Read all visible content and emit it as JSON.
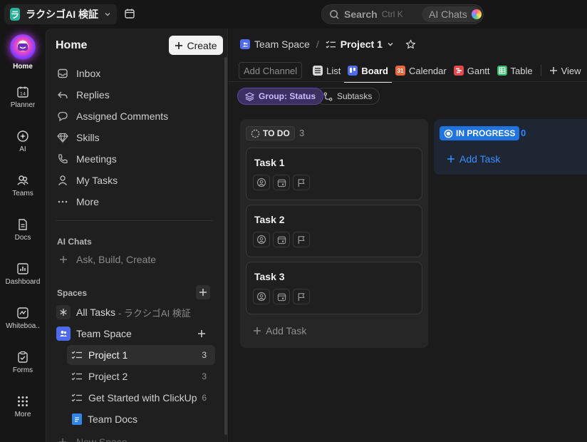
{
  "topbar": {
    "workspace_logo": "ラ",
    "workspace_name": "ラクシゴAI 検証",
    "search_label": "Search",
    "search_shortcut": "Ctrl K",
    "ai_chats_label": "AI Chats"
  },
  "rail": {
    "items": [
      {
        "label": "Home",
        "icon": "home-icon"
      },
      {
        "label": "Planner",
        "icon": "planner-icon"
      },
      {
        "label": "AI",
        "icon": "ai-icon"
      },
      {
        "label": "Teams",
        "icon": "teams-icon"
      },
      {
        "label": "Docs",
        "icon": "docs-icon"
      },
      {
        "label": "Dashboards",
        "display": "Dashboard",
        "icon": "dashboard-icon"
      },
      {
        "label": "Whiteboards",
        "display": "Whiteboa..",
        "icon": "whiteboard-icon"
      },
      {
        "label": "Forms",
        "icon": "forms-icon"
      },
      {
        "label": "More",
        "icon": "grid-icon"
      }
    ]
  },
  "sidebar": {
    "title": "Home",
    "create_label": "Create",
    "nav": [
      {
        "label": "Inbox",
        "icon": "inbox-icon"
      },
      {
        "label": "Replies",
        "icon": "reply-icon"
      },
      {
        "label": "Assigned Comments",
        "icon": "comment-icon"
      },
      {
        "label": "Skills",
        "icon": "diamond-icon"
      },
      {
        "label": "Meetings",
        "icon": "phone-icon"
      },
      {
        "label": "My Tasks",
        "icon": "user-icon"
      },
      {
        "label": "More",
        "icon": "ellipsis-icon"
      }
    ],
    "ai_chats_title": "AI Chats",
    "ai_chats_prompt": "Ask, Build, Create",
    "spaces_title": "Spaces",
    "all_tasks_label": "All Tasks",
    "all_tasks_suffix": "- ラクシゴAI 検証",
    "team_space_label": "Team Space",
    "tree": [
      {
        "label": "Project 1",
        "count": "3",
        "active": true
      },
      {
        "label": "Project 2",
        "count": "3"
      },
      {
        "label": "Get Started with ClickUp",
        "count": "6"
      },
      {
        "label": "Team Docs",
        "count": ""
      }
    ],
    "new_space_label": "New Space"
  },
  "main": {
    "breadcrumb": {
      "space": "Team Space",
      "separator": "/",
      "project": "Project 1"
    },
    "add_channel": "Add Channel",
    "views": [
      {
        "label": "List",
        "icon": "list-icon"
      },
      {
        "label": "Board",
        "icon": "board-icon",
        "active": true
      },
      {
        "label": "Calendar",
        "icon": "calendar-icon",
        "color": "#e8663d",
        "badge": "31"
      },
      {
        "label": "Gantt",
        "icon": "gantt-icon",
        "color": "#e5484d"
      },
      {
        "label": "Table",
        "icon": "table-icon",
        "color": "#2fb86a"
      }
    ],
    "add_view": "View",
    "group_chip": "Group: Status",
    "subtasks_chip": "Subtasks"
  },
  "board": {
    "columns": [
      {
        "status": "TO DO",
        "count": "3",
        "cards": [
          {
            "title": "Task 1"
          },
          {
            "title": "Task 2"
          },
          {
            "title": "Task 3"
          }
        ],
        "add_task": "Add Task"
      },
      {
        "status": "IN PROGRESS",
        "count": "0",
        "cards": [],
        "add_task": "Add Task"
      }
    ]
  },
  "colors": {
    "accent_blue": "#1f74e0",
    "group_purple": "#3b2f63",
    "workspace_green": "#2ab39a"
  }
}
